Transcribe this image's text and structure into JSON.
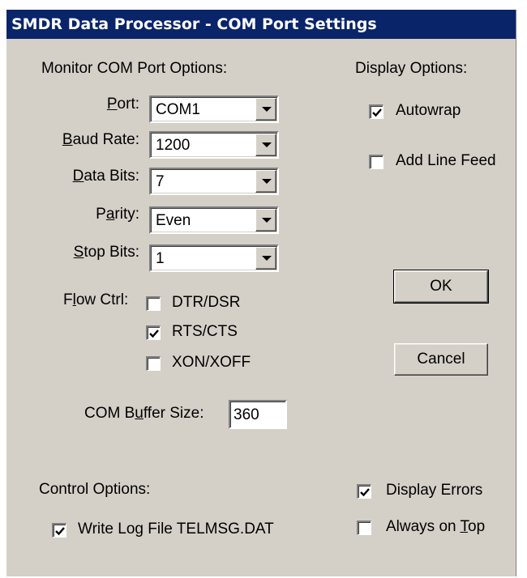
{
  "window": {
    "title": "SMDR Data Processor - COM Port Settings"
  },
  "monitor": {
    "heading": "Monitor COM Port Options:",
    "port": {
      "label_u": "P",
      "label_rest": "ort:",
      "value": "COM1"
    },
    "baud": {
      "label_u": "B",
      "label_rest": "aud Rate:",
      "value": "1200"
    },
    "databits": {
      "label_u": "D",
      "label_rest": "ata Bits:",
      "value": "7"
    },
    "parity": {
      "label_pre": "P",
      "label_u": "a",
      "label_rest": "rity:",
      "value": "Even"
    },
    "stopbits": {
      "label_u": "S",
      "label_rest": "top Bits:",
      "value": "1"
    },
    "flow": {
      "label_pre": "F",
      "label_u": "l",
      "label_rest": "ow Ctrl:",
      "options": [
        {
          "label": "DTR/DSR",
          "checked": false
        },
        {
          "label": "RTS/CTS",
          "checked": true
        },
        {
          "label": "XON/XOFF",
          "checked": false
        }
      ]
    },
    "buffer": {
      "label_pre": "COM B",
      "label_u": "u",
      "label_rest": "ffer Size:",
      "value": "360"
    }
  },
  "display": {
    "heading": "Display Options:",
    "autowrap": {
      "label": "Autowrap",
      "checked": true
    },
    "linefeed": {
      "label": "Add Line Feed",
      "checked": false
    }
  },
  "buttons": {
    "ok": "OK",
    "cancel": "Cancel"
  },
  "control": {
    "heading": "Control Options:",
    "writelog": {
      "label": "Write Log File TELMSG.DAT",
      "checked": true
    }
  },
  "extra": {
    "errors": {
      "label": "Display Errors",
      "checked": true
    },
    "ontop": {
      "label_pre": "Always on ",
      "label_u": "T",
      "label_rest": "op",
      "checked": false
    }
  },
  "icons": {
    "check": "check-mark-icon",
    "dropdown": "dropdown-arrow-icon"
  }
}
